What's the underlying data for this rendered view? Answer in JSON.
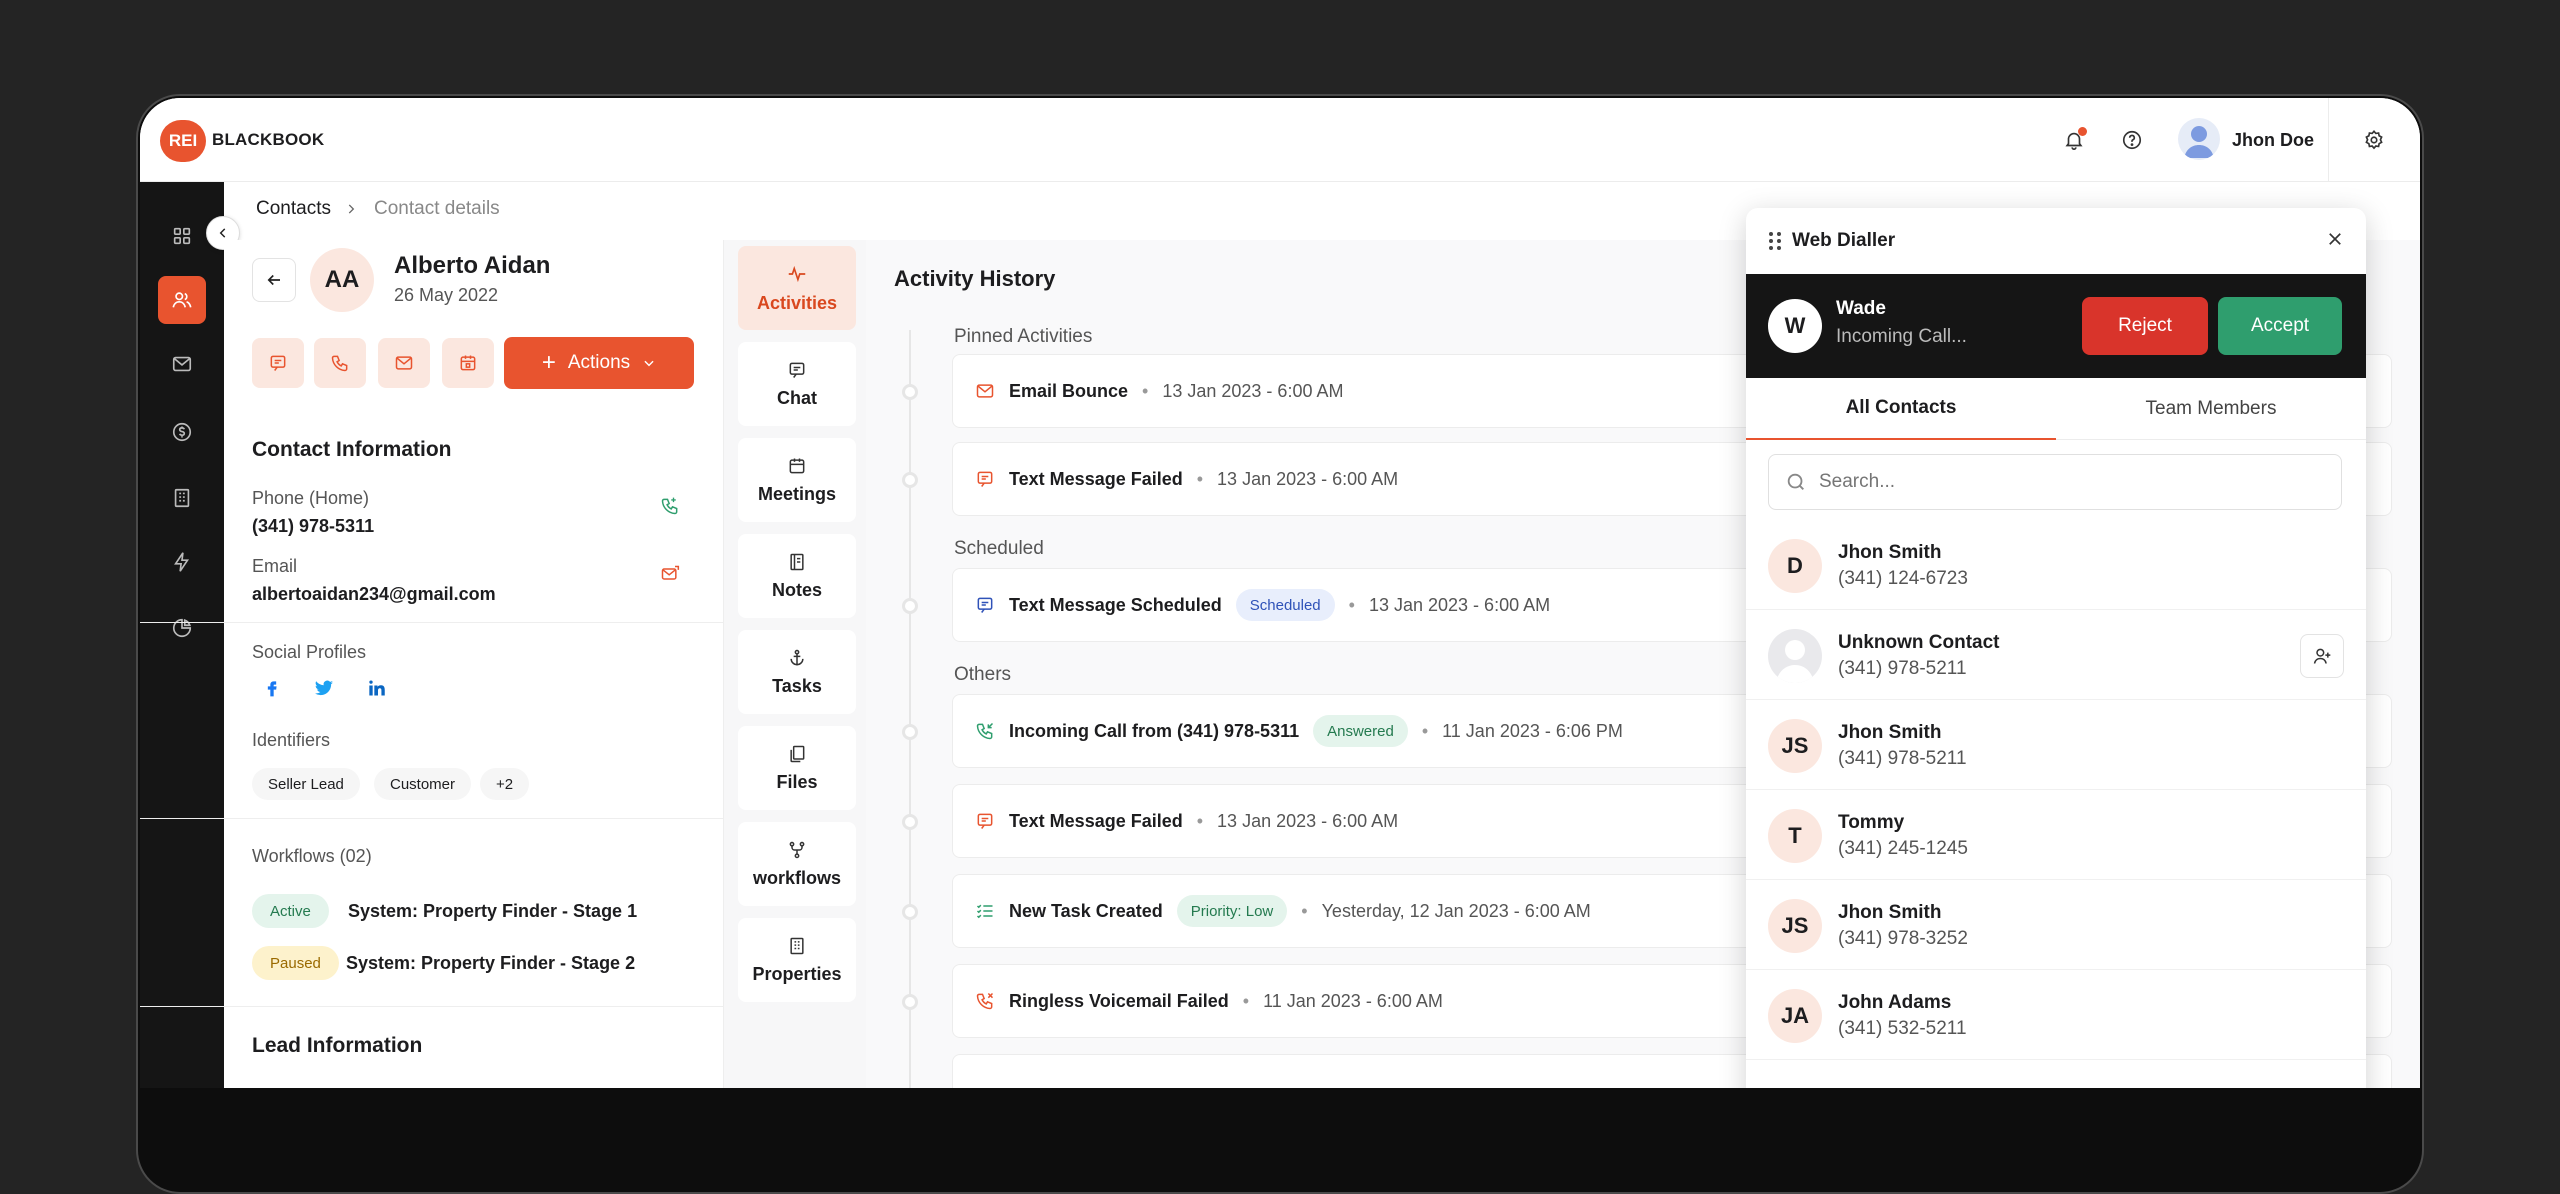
{
  "brand": {
    "badge": "REI",
    "name": "BLACKBOOK",
    "accent": "#e8542f"
  },
  "header": {
    "user_name": "Jhon Doe"
  },
  "breadcrumb": {
    "root": "Contacts",
    "current": "Contact details"
  },
  "contact": {
    "initials": "AA",
    "name": "Alberto Aidan",
    "date": "26 May 2022",
    "actions_label": "Actions",
    "info_title": "Contact Information",
    "phone_label": "Phone (Home)",
    "phone_value": "(341) 978-5311",
    "email_label": "Email",
    "email_value": "albertoaidan234@gmail.com",
    "social_label": "Social Profiles",
    "identifiers_label": "Identifiers",
    "identifiers": [
      "Seller Lead",
      "Customer",
      "+2"
    ],
    "workflows_title": "Workflows (02)",
    "workflows": [
      {
        "status": "Active",
        "name": "System: Property Finder - Stage 1"
      },
      {
        "status": "Paused",
        "name": "System: Property Finder - Stage 2"
      }
    ],
    "lead_title": "Lead Information"
  },
  "tabs": [
    "Activities",
    "Chat",
    "Meetings",
    "Notes",
    "Tasks",
    "Files",
    "workflows",
    "Properties"
  ],
  "activity": {
    "title": "Activity History",
    "groups": {
      "pinned": "Pinned Activities",
      "scheduled": "Scheduled",
      "others": "Others"
    },
    "items": [
      {
        "title": "Email Bounce",
        "badge": "",
        "time": "13 Jan 2023 - 6:00 AM"
      },
      {
        "title": "Text Message Failed",
        "badge": "",
        "time": "13 Jan 2023 - 6:00 AM"
      },
      {
        "title": "Text Message Scheduled",
        "badge": "Scheduled",
        "time": "13 Jan 2023 - 6:00 AM"
      },
      {
        "title": "Incoming Call from (341) 978-5311",
        "badge": "Answered",
        "time": "11 Jan 2023 - 6:06 PM"
      },
      {
        "title": "Text Message Failed",
        "badge": "",
        "time": "13 Jan 2023 - 6:00 AM"
      },
      {
        "title": "New Task Created",
        "badge": "Priority: Low",
        "time": "Yesterday, 12 Jan 2023 - 6:00 AM"
      },
      {
        "title": "Ringless Voicemail Failed",
        "badge": "",
        "time": "11 Jan 2023 - 6:00 AM"
      }
    ]
  },
  "dialler": {
    "title": "Web Dialler",
    "caller_initial": "W",
    "caller_name": "Wade",
    "caller_status": "Incoming Call...",
    "reject_label": "Reject",
    "accept_label": "Accept",
    "tab_all": "All Contacts",
    "tab_team": "Team Members",
    "search_placeholder": "Search...",
    "contacts": [
      {
        "initials": "D",
        "name": "Jhon Smith",
        "phone": "(341) 124-6723"
      },
      {
        "initials": "",
        "name": "Unknown Contact",
        "phone": "(341) 978-5211"
      },
      {
        "initials": "JS",
        "name": "Jhon Smith",
        "phone": "(341) 978-5211"
      },
      {
        "initials": "T",
        "name": "Tommy",
        "phone": "(341) 245-1245"
      },
      {
        "initials": "JS",
        "name": "Jhon Smith",
        "phone": "(341) 978-3252"
      },
      {
        "initials": "JA",
        "name": "John Adams",
        "phone": "(341) 532-5211"
      }
    ]
  },
  "colors": {
    "reject": "#d9342b",
    "accept": "#2f9e6e",
    "active_badge": "#e4f4ec",
    "paused_badge": "#fdf2cc"
  }
}
